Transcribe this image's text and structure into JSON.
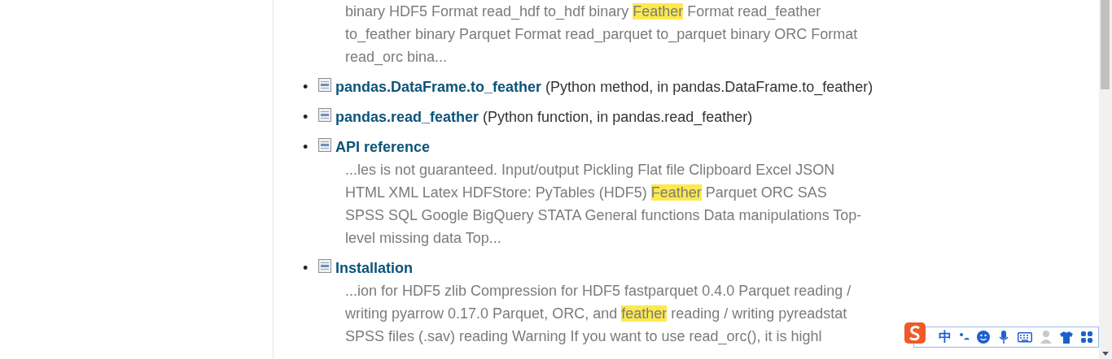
{
  "results": [
    {
      "snippet": [
        {
          "text": "binary HDF5 Format read_hdf to_hdf binary ",
          "highlighted": false
        },
        {
          "text": "Feather",
          "highlighted": true
        },
        {
          "text": " Format read_feather to_feather binary Parquet Format read_parquet to_parquet binary ORC Format read_orc bina...",
          "highlighted": false
        }
      ]
    },
    {
      "marker": "•",
      "title": "pandas.DataFrame.to_feather",
      "description": "(Python method, in pandas.DataFrame.to_feather)"
    },
    {
      "marker": "•",
      "title": "pandas.read_feather",
      "description": "(Python function, in pandas.read_feather)"
    },
    {
      "marker": "•",
      "title": "API reference",
      "snippet": [
        {
          "text": "...les is not guaranteed. Input/output Pickling Flat file Clipboard Excel JSON HTML XML Latex HDFStore: PyTables (HDF5) ",
          "highlighted": false
        },
        {
          "text": "Feather",
          "highlighted": true
        },
        {
          "text": " Parquet ORC SAS SPSS SQL Google BigQuery STATA General functions Data manipulations Top-level missing data Top...",
          "highlighted": false
        }
      ]
    },
    {
      "marker": "•",
      "title": "Installation",
      "snippet": [
        {
          "text": "...ion for HDF5 zlib Compression for HDF5 fastparquet 0.4.0 Parquet reading / writing pyarrow 0.17.0 Parquet, ORC, and ",
          "highlighted": false
        },
        {
          "text": "feather",
          "highlighted": true
        },
        {
          "text": " reading / writing pyreadstat SPSS files (.sav) reading Warning If you want to use read_orc(), it is highl",
          "highlighted": false
        }
      ]
    }
  ],
  "ime_toolbar": {
    "mode": "中"
  }
}
